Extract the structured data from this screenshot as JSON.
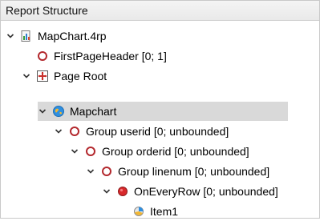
{
  "panel": {
    "title": "Report Structure"
  },
  "tree": {
    "root": {
      "label": "MapChart.4rp"
    },
    "first_page_header": {
      "label": "FirstPageHeader [0; 1]"
    },
    "page_root": {
      "label": "Page Root"
    },
    "mapchart": {
      "label": "Mapchart"
    },
    "group_userid": {
      "label": "Group userid [0; unbounded]"
    },
    "group_orderid": {
      "label": "Group orderid [0; unbounded]"
    },
    "group_linenum": {
      "label": "Group linenum [0; unbounded]"
    },
    "on_every_row": {
      "label": "OnEveryRow [0; unbounded]"
    },
    "item1": {
      "label": "Item1"
    }
  }
}
